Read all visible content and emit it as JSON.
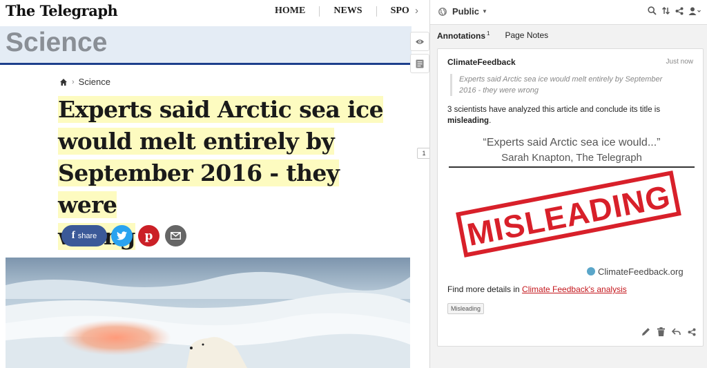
{
  "colors": {
    "telegraph_blue": "#1d3f8c",
    "section_band": "#e4ecf5",
    "headline_highlight": "#fdfbc0",
    "facebook": "#3b5998",
    "twitter": "#2aa3ef",
    "pinterest": "#cb2027",
    "email": "#666666",
    "misleading_red": "#d8202a"
  },
  "article": {
    "logo": "The Telegraph",
    "nav": [
      "HOME",
      "NEWS",
      "SPO"
    ],
    "section": "Science",
    "breadcrumb": {
      "icon": "home-icon",
      "label": "Science"
    },
    "headline_lines": [
      "Experts said Arctic sea ice",
      "would melt entirely by",
      "September 2016 - they were",
      "wrong"
    ],
    "share": {
      "facebook_label": "share",
      "facebook_glyph": "f",
      "pinterest_glyph": "p",
      "twitter_icon": "twitter-bird-icon",
      "email_icon": "envelope-icon"
    },
    "photo_alt_icon": "polar-bear-photo"
  },
  "gutter": {
    "toggle_icon": "chevron-right-icon",
    "eye_icon": "eye-icon",
    "notes_icon": "page-notes-icon",
    "annotation_count": "1"
  },
  "sidebar": {
    "privacy": "Public",
    "privacy_icon": "globe-icon",
    "toolbar_icons": [
      "search-icon",
      "sort-icon",
      "share-icon",
      "user-icon"
    ],
    "tabs": [
      {
        "label": "Annotations",
        "count": "1",
        "active": true
      },
      {
        "label": "Page Notes",
        "count": "",
        "active": false
      }
    ],
    "annotation": {
      "author": "ClimateFeedback",
      "time": "Just now",
      "quote": "Experts said Arctic sea ice would melt entirely by September 2016 - they were wrong",
      "body_prefix": "3 scientists have analyzed this article and conclude its title is ",
      "body_bold": "misleading",
      "body_suffix": ".",
      "image": {
        "quote_line": "“Experts said Arctic sea ice would...”",
        "byline": "Sarah Knapton, The Telegraph",
        "stamp": "MISLEADING",
        "brand": "ClimateFeedback.org"
      },
      "details_prefix": "Find more details in ",
      "details_link": "Climate Feedback's analysis",
      "tag": "Misleading",
      "actions": [
        "edit-icon",
        "delete-icon",
        "reply-icon",
        "share-icon"
      ]
    }
  }
}
